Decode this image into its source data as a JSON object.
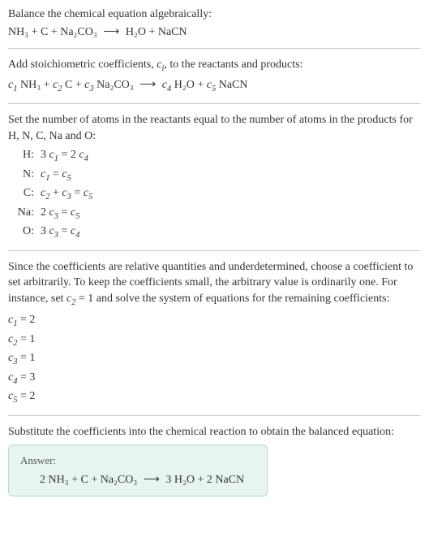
{
  "intro": {
    "line1": "Balance the chemical equation algebraically:",
    "equation_lhs": "NH₃ + C + Na₂CO₃",
    "arrow": "⟶",
    "equation_rhs": "H₂O + NaCN"
  },
  "step1": {
    "text": "Add stoichiometric coefficients, ",
    "ci": "c",
    "ci_sub": "i",
    "text2": ", to the reactants and products:",
    "eq_parts": {
      "c1": "c",
      "c1s": "1",
      "sp1": " NH₃ + ",
      "c2": "c",
      "c2s": "2",
      "sp2": " C + ",
      "c3": "c",
      "c3s": "3",
      "sp3": " Na₂CO₃",
      "arrow": "⟶",
      "c4": "c",
      "c4s": "4",
      "sp4": " H₂O + ",
      "c5": "c",
      "c5s": "5",
      "sp5": " NaCN"
    }
  },
  "step2": {
    "text": "Set the number of atoms in the reactants equal to the number of atoms in the products for H, N, C, Na and O:",
    "rows": [
      {
        "label": "H:",
        "lhs_pre": "3 ",
        "c_a": "c",
        "c_as": "1",
        "mid": " = 2 ",
        "c_b": "c",
        "c_bs": "4",
        "post": ""
      },
      {
        "label": "N:",
        "lhs_pre": "",
        "c_a": "c",
        "c_as": "1",
        "mid": " = ",
        "c_b": "c",
        "c_bs": "5",
        "post": ""
      },
      {
        "label": "C:",
        "lhs_pre": "",
        "c_a": "c",
        "c_as": "2",
        "mid": " + ",
        "c_b": "c",
        "c_bs": "3",
        "post_eq": " = ",
        "c_c": "c",
        "c_cs": "5"
      },
      {
        "label": "Na:",
        "lhs_pre": "2 ",
        "c_a": "c",
        "c_as": "3",
        "mid": " = ",
        "c_b": "c",
        "c_bs": "5",
        "post": ""
      },
      {
        "label": "O:",
        "lhs_pre": "3 ",
        "c_a": "c",
        "c_as": "3",
        "mid": " = ",
        "c_b": "c",
        "c_bs": "4",
        "post": ""
      }
    ]
  },
  "step3": {
    "text1": "Since the coefficients are relative quantities and underdetermined, choose a coefficient to set arbitrarily. To keep the coefficients small, the arbitrary value is ordinarily one. For instance, set ",
    "c2": "c",
    "c2s": "2",
    "text2": " = 1 and solve the system of equations for the remaining coefficients:",
    "coeffs": [
      {
        "c": "c",
        "s": "1",
        "v": " = 2"
      },
      {
        "c": "c",
        "s": "2",
        "v": " = 1"
      },
      {
        "c": "c",
        "s": "3",
        "v": " = 1"
      },
      {
        "c": "c",
        "s": "4",
        "v": " = 3"
      },
      {
        "c": "c",
        "s": "5",
        "v": " = 2"
      }
    ]
  },
  "step4": {
    "text": "Substitute the coefficients into the chemical reaction to obtain the balanced equation:"
  },
  "answer": {
    "label": "Answer:",
    "lhs": "2 NH₃ + C + Na₂CO₃",
    "arrow": "⟶",
    "rhs": "3 H₂O + 2 NaCN"
  }
}
